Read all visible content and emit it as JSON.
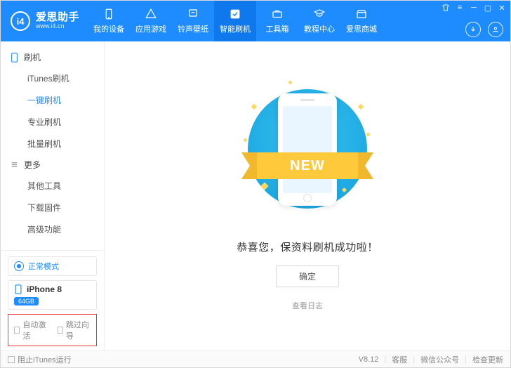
{
  "app": {
    "name": "爱思助手",
    "site": "www.i4.cn",
    "logo_short": "i4"
  },
  "nav": [
    {
      "label": "我的设备",
      "icon": "device"
    },
    {
      "label": "应用游戏",
      "icon": "apps"
    },
    {
      "label": "铃声壁纸",
      "icon": "ringtone"
    },
    {
      "label": "智能刷机",
      "icon": "flash",
      "active": true
    },
    {
      "label": "工具箱",
      "icon": "toolbox"
    },
    {
      "label": "教程中心",
      "icon": "tutorial"
    },
    {
      "label": "爱思商城",
      "icon": "store"
    }
  ],
  "sidebar": {
    "section1": {
      "title": "刷机",
      "items": [
        "iTunes刷机",
        "一键刷机",
        "专业刷机",
        "批量刷机"
      ],
      "active_index": 1
    },
    "section2": {
      "title": "更多",
      "items": [
        "其他工具",
        "下载固件",
        "高级功能"
      ]
    }
  },
  "mode_label": "正常模式",
  "device": {
    "name": "iPhone 8",
    "capacity": "64GB"
  },
  "options": {
    "auto_activate": "自动激活",
    "skip_guide": "跳过向导"
  },
  "main": {
    "ribbon": "NEW",
    "message": "恭喜您，保资料刷机成功啦！",
    "ok": "确定",
    "view_log": "查看日志"
  },
  "footer": {
    "block_itunes": "阻止iTunes运行",
    "version": "V8.12",
    "support": "客服",
    "wechat": "微信公众号",
    "update": "检查更新"
  }
}
